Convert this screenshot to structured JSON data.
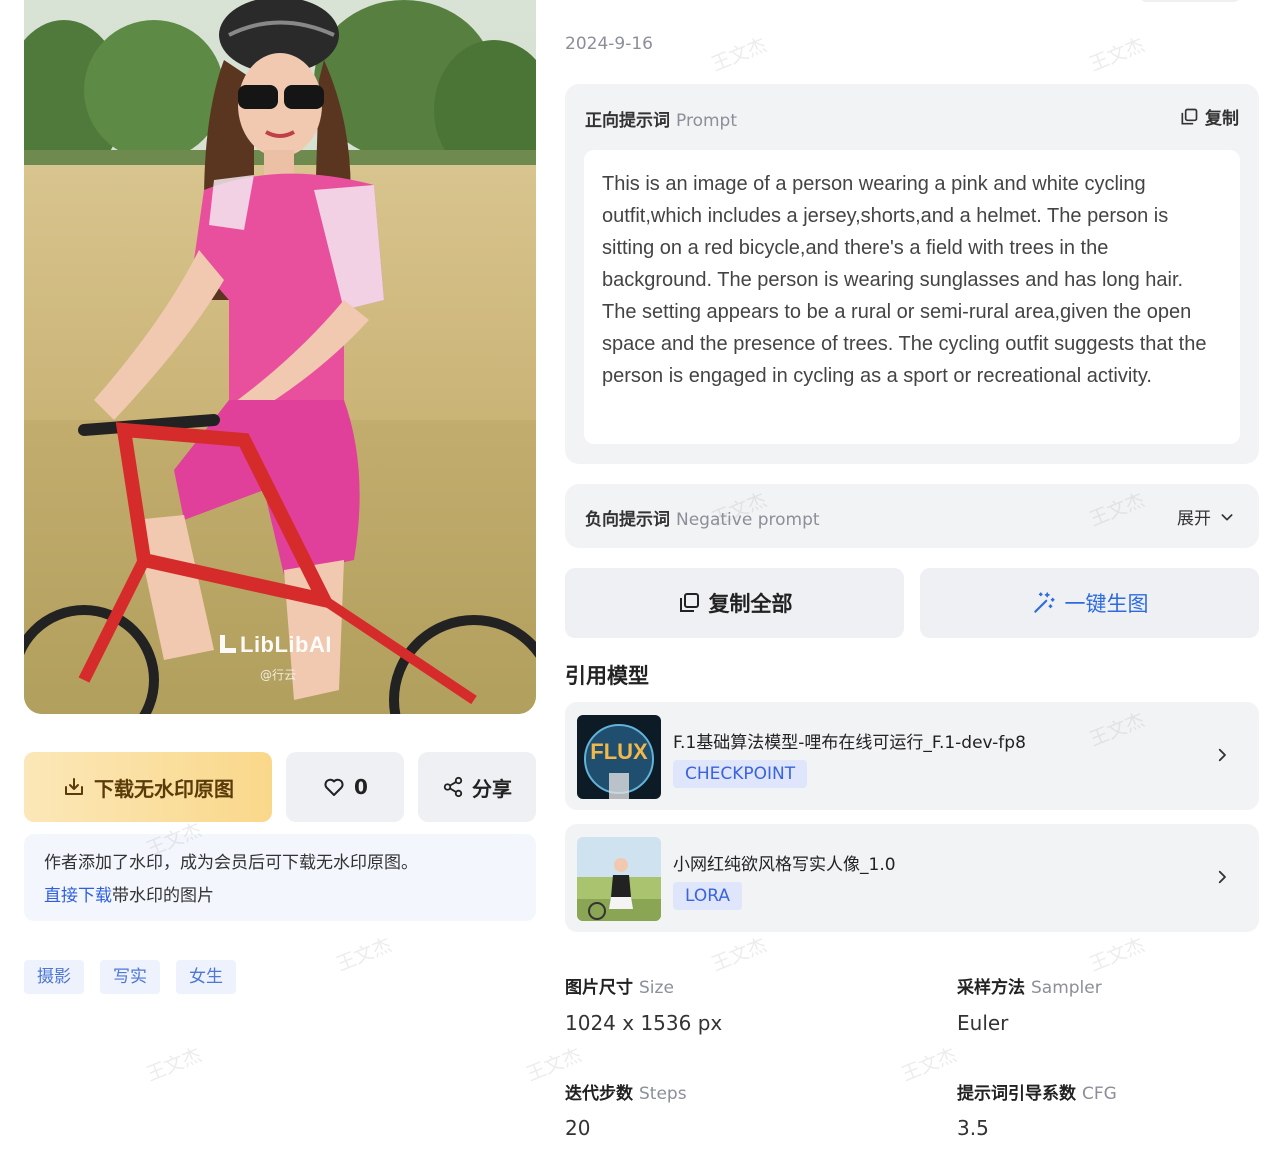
{
  "image": {
    "watermark_brand": "LibLibAI",
    "watermark_credit": "@行云"
  },
  "actions_left": {
    "download_label": "下载无水印原图",
    "like_count": "0",
    "share_label": "分享"
  },
  "notice": {
    "text": "作者添加了水印，成为会员后可下载无水印原图。",
    "link_label": "直接下载",
    "link_suffix": "带水印的图片"
  },
  "tags": [
    "摄影",
    "写实",
    "女生"
  ],
  "date": "2024-9-16",
  "prompt": {
    "title": "正向提示词",
    "title_sub": "Prompt",
    "copy_label": "复制",
    "text": "This is an image of a person wearing a pink and white cycling outfit,which includes a jersey,shorts,and a helmet. The person is sitting on a red bicycle,and there's a field with trees in the background. The person is wearing sunglasses and has long hair. The setting appears to be a rural or semi-rural area,given the open space and the presence of trees. The cycling outfit suggests that the person is engaged in cycling as a sport or recreational activity."
  },
  "negative": {
    "title": "负向提示词",
    "title_sub": "Negative prompt",
    "expand_label": "展开"
  },
  "buttons": {
    "copy_all": "复制全部",
    "generate": "一键生图"
  },
  "models_section": {
    "title": "引用模型",
    "items": [
      {
        "name": "F.1基础算法模型-哩布在线可运行_F.1-dev-fp8",
        "type": "CHECKPOINT",
        "thumb_text": "FLUX"
      },
      {
        "name": "小网红纯欲风格写实人像_1.0",
        "type": "LORA"
      }
    ]
  },
  "params": {
    "size": {
      "label": "图片尺寸",
      "sub": "Size",
      "value": "1024 x 1536 px"
    },
    "sampler": {
      "label": "采样方法",
      "sub": "Sampler",
      "value": "Euler"
    },
    "steps": {
      "label": "迭代步数",
      "sub": "Steps",
      "value": "20"
    },
    "cfg": {
      "label": "提示词引导系数",
      "sub": "CFG",
      "value": "3.5"
    }
  },
  "overlay_watermark": "王文杰",
  "colors": {
    "accent_blue": "#2d6be0",
    "download_gold": "#fad88a",
    "panel_bg": "#f2f3f5",
    "tag_text": "#4d76d6"
  }
}
